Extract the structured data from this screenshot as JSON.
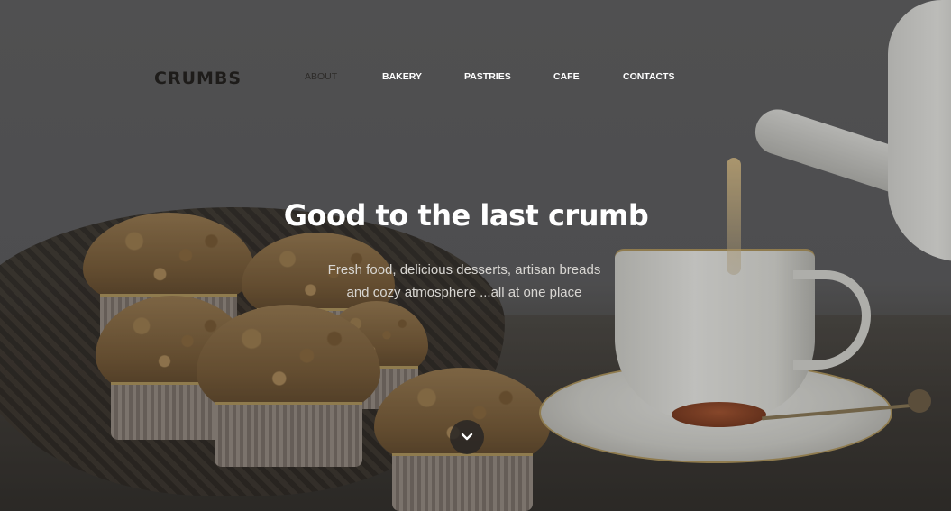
{
  "brand": {
    "logo_text": "CRUMBS"
  },
  "nav": {
    "items": [
      {
        "label": "ABOUT",
        "active": true
      },
      {
        "label": "BAKERY",
        "active": false
      },
      {
        "label": "PASTRIES",
        "active": false
      },
      {
        "label": "CAFE",
        "active": false
      },
      {
        "label": "CONTACTS",
        "active": false
      }
    ]
  },
  "hero": {
    "headline": "Good to the last crumb",
    "subtext_line1": "Fresh food, delicious desserts, artisan breads",
    "subtext_line2": "and cozy atmosphere ...all at one place",
    "scroll_icon": "chevron-down-icon"
  },
  "colors": {
    "nav_active": "#2d2b29",
    "nav_default": "#ffffff",
    "headline": "#ffffff",
    "background": "#5f5f61"
  }
}
